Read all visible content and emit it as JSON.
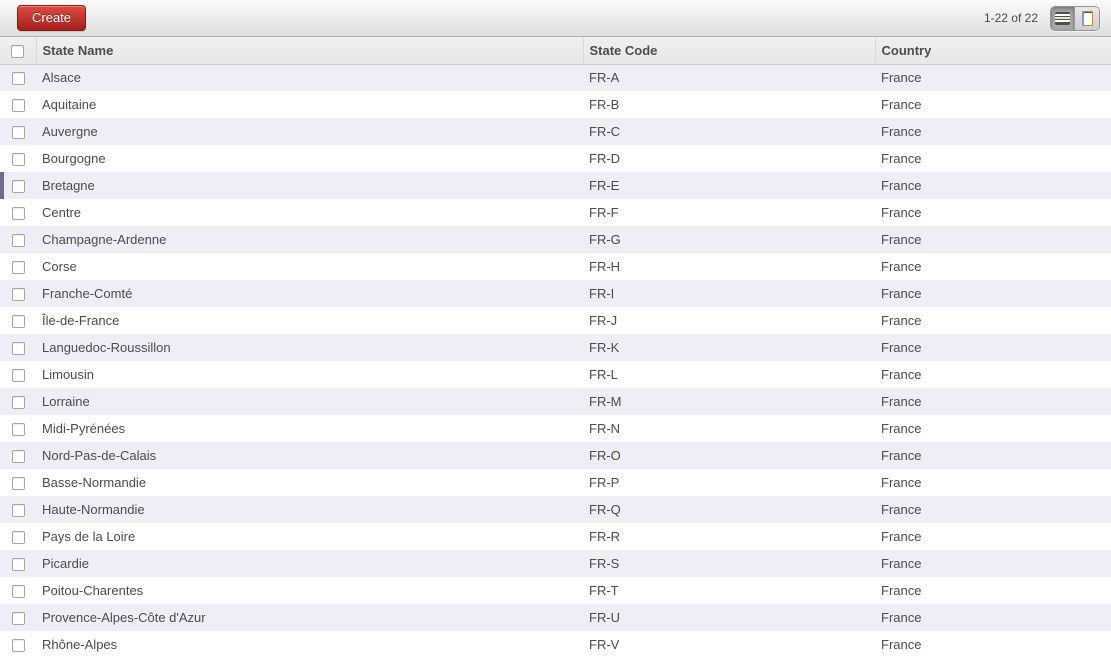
{
  "toolbar": {
    "create_label": "Create",
    "pager": "1-22 of 22"
  },
  "table": {
    "headers": {
      "name": "State Name",
      "code": "State Code",
      "country": "Country"
    }
  },
  "rows": [
    {
      "name": "Alsace",
      "code": "FR-A",
      "country": "France"
    },
    {
      "name": "Aquitaine",
      "code": "FR-B",
      "country": "France"
    },
    {
      "name": "Auvergne",
      "code": "FR-C",
      "country": "France"
    },
    {
      "name": "Bourgogne",
      "code": "FR-D",
      "country": "France"
    },
    {
      "name": "Bretagne",
      "code": "FR-E",
      "country": "France",
      "highlighted": true
    },
    {
      "name": "Centre",
      "code": "FR-F",
      "country": "France"
    },
    {
      "name": "Champagne-Ardenne",
      "code": "FR-G",
      "country": "France"
    },
    {
      "name": "Corse",
      "code": "FR-H",
      "country": "France"
    },
    {
      "name": "Franche-Comté",
      "code": "FR-I",
      "country": "France"
    },
    {
      "name": "Île-de-France",
      "code": "FR-J",
      "country": "France"
    },
    {
      "name": "Languedoc-Roussillon",
      "code": "FR-K",
      "country": "France"
    },
    {
      "name": "Limousin",
      "code": "FR-L",
      "country": "France"
    },
    {
      "name": "Lorraine",
      "code": "FR-M",
      "country": "France"
    },
    {
      "name": "Midi-Pyrénées",
      "code": "FR-N",
      "country": "France"
    },
    {
      "name": "Nord-Pas-de-Calais",
      "code": "FR-O",
      "country": "France"
    },
    {
      "name": "Basse-Normandie",
      "code": "FR-P",
      "country": "France"
    },
    {
      "name": "Haute-Normandie",
      "code": "FR-Q",
      "country": "France"
    },
    {
      "name": "Pays de la Loire",
      "code": "FR-R",
      "country": "France"
    },
    {
      "name": "Picardie",
      "code": "FR-S",
      "country": "France"
    },
    {
      "name": "Poitou-Charentes",
      "code": "FR-T",
      "country": "France"
    },
    {
      "name": "Provence-Alpes-Côte d'Azur",
      "code": "FR-U",
      "country": "France"
    },
    {
      "name": "Rhône-Alpes",
      "code": "FR-V",
      "country": "France"
    }
  ],
  "icons": {
    "list_view": "list-view-icon",
    "form_view": "form-view-icon"
  },
  "colors": {
    "accent_red_light": "#e04b41",
    "accent_red_dark": "#a32019",
    "stripe": "#eeeef6",
    "marker": "#6b6b94"
  }
}
